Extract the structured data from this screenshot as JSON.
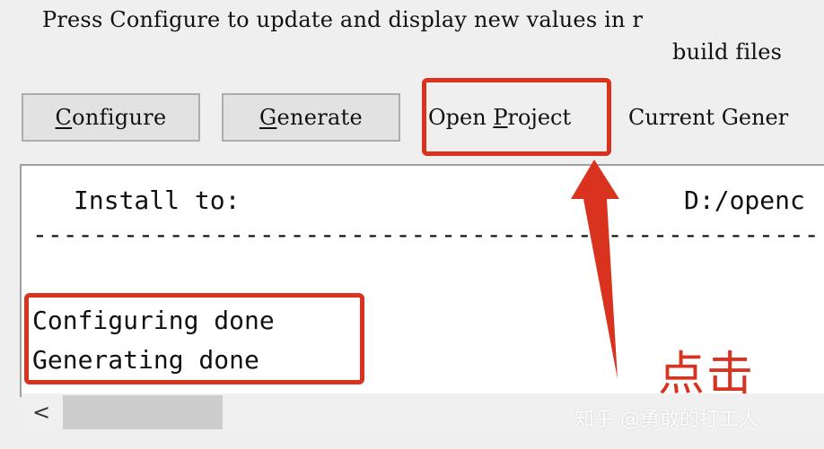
{
  "info": {
    "line1": "Press Configure to update and display new values in r",
    "line2": "build files"
  },
  "buttons": {
    "configure_prefix": "C",
    "configure_rest": "onfigure",
    "generate_prefix": "G",
    "generate_rest": "enerate",
    "open_project_a": "Open ",
    "open_project_b": "P",
    "open_project_c": "roject",
    "current_generator": "Current Gener"
  },
  "output": {
    "install_label": "Install to:",
    "install_path": "D:/openc",
    "separator": "----------------------------------------------------",
    "log": [
      "Configuring done",
      "Generating done"
    ]
  },
  "scrollbar": {
    "left_arrow": "<"
  },
  "annotations": {
    "click_note": "点击",
    "watermark": "知乎 @勇敢的打工人",
    "accent_color": "#d9321f"
  }
}
